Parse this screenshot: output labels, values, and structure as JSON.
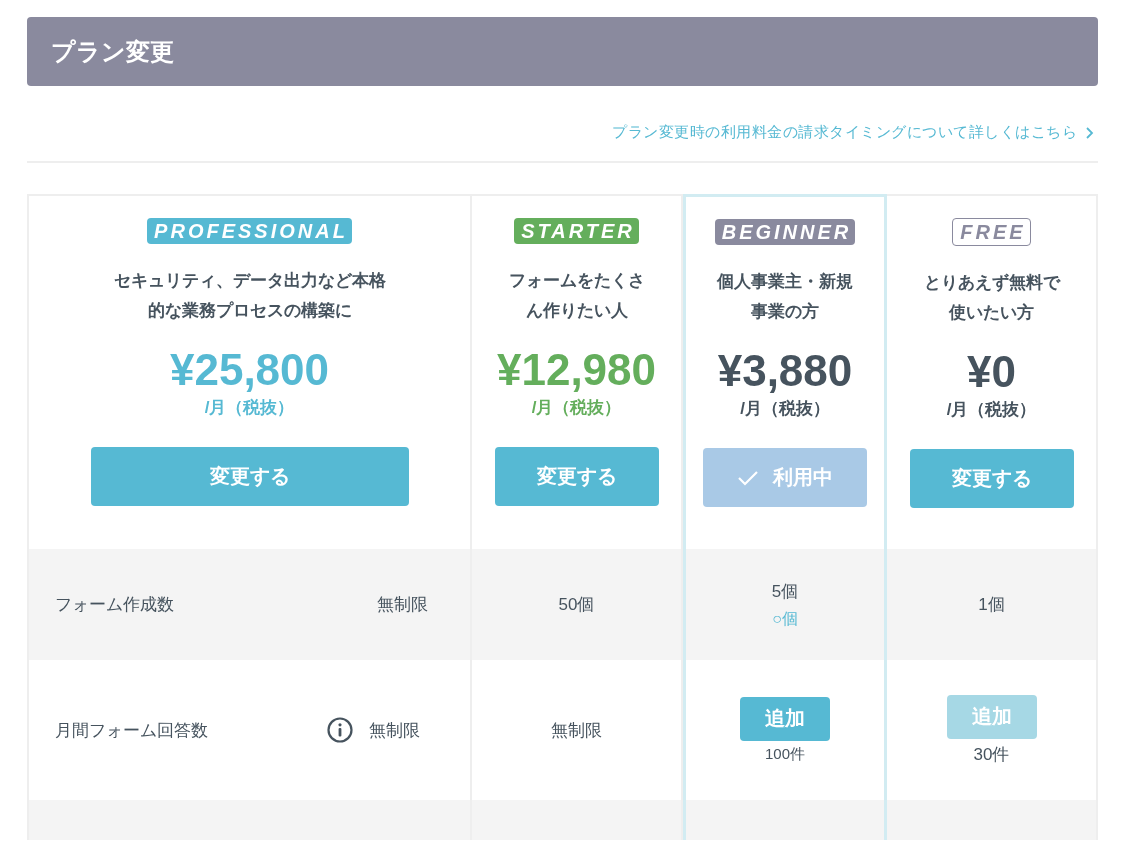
{
  "header": {
    "title": "プラン変更"
  },
  "billing_link": {
    "label": "プラン変更時の利用料金の請求タイミングについて詳しくはこちら"
  },
  "plans": [
    {
      "badge": "PROFESSIONAL",
      "kind": "filled",
      "color": "#56b9d3",
      "description": "セキュリティ、データ出力など本格的な業務プロセスの構築に",
      "price": "¥25,800",
      "unit": "/月（税抜）",
      "price_accent": true,
      "button": "変更する",
      "selected": false
    },
    {
      "badge": "STARTER",
      "kind": "filled",
      "color": "#64ae5c",
      "description": "フォームをたくさん作りたい人",
      "price": "¥12,980",
      "unit": "/月（税抜）",
      "price_accent": true,
      "button": "変更する",
      "selected": false
    },
    {
      "badge": "BEGINNER",
      "kind": "filled",
      "color": "#8a8a9e",
      "description": "個人事業主・新規事業の方",
      "price": "¥3,880",
      "unit": "/月（税抜）",
      "price_accent": false,
      "button": "利用中",
      "selected": true
    },
    {
      "badge": "FREE",
      "kind": "outline",
      "color": "#8a8a9e",
      "description": "とりあえず無料で使いたい方",
      "price": "¥0",
      "unit": "/月（税抜）",
      "price_accent": false,
      "button": "変更する",
      "selected": false
    }
  ],
  "features": [
    {
      "label": "フォーム作成数",
      "info": false,
      "values": [
        {
          "text": "無制限"
        },
        {
          "text": "50個"
        },
        {
          "text": "5個",
          "note": "○個"
        },
        {
          "text": "1個"
        }
      ]
    },
    {
      "label": "月間フォーム回答数",
      "info": true,
      "values": [
        {
          "text": "無制限"
        },
        {
          "text": "無制限"
        },
        {
          "add": {
            "label": "追加",
            "disabled": false
          },
          "text": "100件"
        },
        {
          "add": {
            "label": "追加",
            "disabled": true
          },
          "text": "30件"
        }
      ]
    }
  ]
}
